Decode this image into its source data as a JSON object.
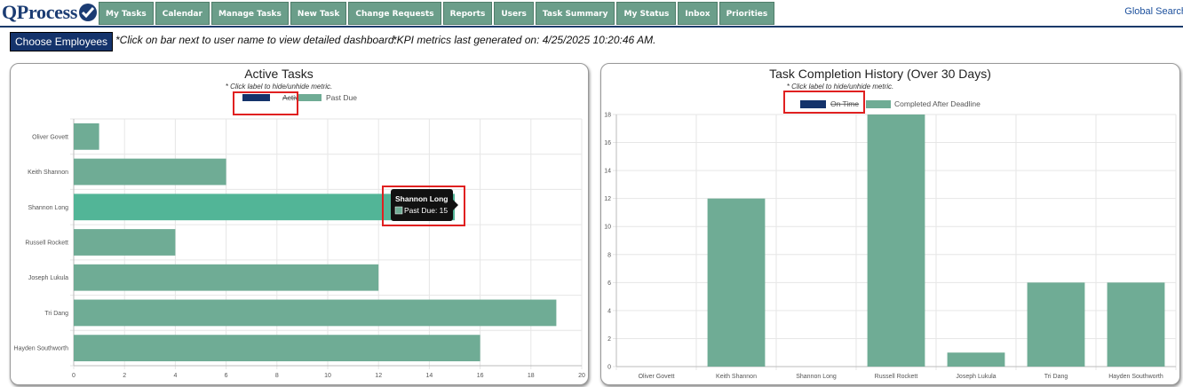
{
  "app": {
    "logo_text": "QProcess",
    "global_search": "Global Search"
  },
  "nav": [
    "My Tasks",
    "Calendar",
    "Manage Tasks",
    "New Task",
    "Change Requests",
    "Reports",
    "Users",
    "Task Summary",
    "My Status",
    "Inbox",
    "Priorities"
  ],
  "toolbar": {
    "choose_label": "Choose Employees",
    "note_click": "*Click on bar next to user name to view detailed dashboard.",
    "note_kpi": "*KPI metrics last generated on: 4/25/2025 10:20:46 AM."
  },
  "colors": {
    "active": "#14336b",
    "bar": "#6fac95",
    "bar_hover": "#52b597",
    "highlight_box": "#e02020"
  },
  "active_tasks": {
    "hint": "* Click label to hide/unhide metric.",
    "legend": [
      {
        "label": "Active",
        "hidden": true
      },
      {
        "label": "Past Due",
        "hidden": false
      }
    ],
    "tooltip": {
      "title": "Shannon Long",
      "label": "Past Due: 15"
    }
  },
  "history": {
    "hint": "* Click label to hide/unhide metric.",
    "legend": [
      {
        "label": "On Time",
        "hidden": true
      },
      {
        "label": "Completed After Deadline",
        "hidden": false
      }
    ]
  },
  "chart_data": [
    {
      "type": "bar",
      "orientation": "horizontal",
      "title": "Active Tasks",
      "categories": [
        "Oliver Govett",
        "Keith Shannon",
        "Shannon Long",
        "Russell Rockett",
        "Joseph Lukula",
        "Tri Dang",
        "Hayden Southworth"
      ],
      "series": [
        {
          "name": "Past Due",
          "values": [
            1,
            6,
            15,
            4,
            12,
            19,
            16
          ]
        }
      ],
      "xlim": [
        0,
        20
      ],
      "xticks": [
        0,
        2,
        4,
        6,
        8,
        10,
        12,
        14,
        16,
        18,
        20
      ],
      "grid": true,
      "legend": "top"
    },
    {
      "type": "bar",
      "orientation": "vertical",
      "title": "Task Completion History (Over 30 Days)",
      "categories": [
        "Oliver Govett",
        "Keith Shannon",
        "Shannon Long",
        "Russell Rockett",
        "Joseph Lukula",
        "Tri Dang",
        "Hayden Southworth"
      ],
      "series": [
        {
          "name": "Completed After Deadline",
          "values": [
            0,
            12,
            0,
            18,
            1,
            6,
            6
          ]
        }
      ],
      "ylim": [
        0,
        18
      ],
      "yticks": [
        0,
        2,
        4,
        6,
        8,
        10,
        12,
        14,
        16,
        18
      ],
      "grid": true,
      "legend": "top"
    }
  ]
}
